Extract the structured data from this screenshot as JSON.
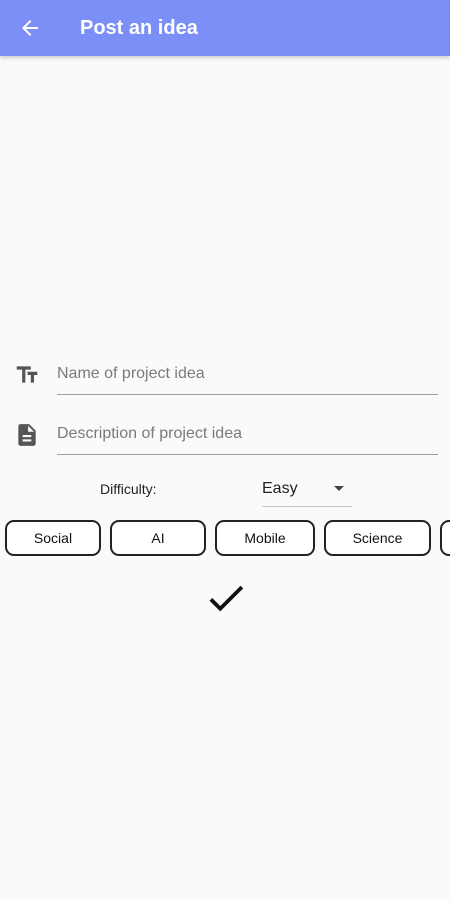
{
  "appbar": {
    "title": "Post an idea",
    "back_icon": "arrow-left-icon",
    "color": "#7b8ff7"
  },
  "form": {
    "name_field": {
      "icon": "text-size-icon",
      "value": "",
      "placeholder": "Name of project idea"
    },
    "description_field": {
      "icon": "document-icon",
      "value": "",
      "placeholder": "Description of project idea"
    },
    "difficulty": {
      "label": "Difficulty:",
      "selected": "Easy"
    },
    "categories": [
      {
        "label": "Social"
      },
      {
        "label": "AI"
      },
      {
        "label": "Mobile"
      },
      {
        "label": "Science"
      },
      {
        "label": ""
      }
    ],
    "submit_icon": "checkmark-icon"
  }
}
